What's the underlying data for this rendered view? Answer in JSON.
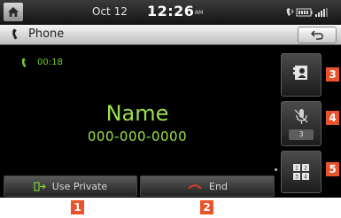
{
  "status_bar": {
    "date": "Oct 12",
    "time": "12:26",
    "ampm": "AM",
    "icons": [
      "home-icon",
      "bluetooth-phone-icon",
      "battery-icon",
      "signal-icon"
    ]
  },
  "title_bar": {
    "title": "Phone",
    "icon": "phone-icon",
    "back_icon": "back-arrow-icon"
  },
  "call": {
    "timer": "00:18",
    "name": "Name",
    "number": "000-000-0000"
  },
  "side_buttons": {
    "contacts_icon": "contacts-icon",
    "mute_icon": "mic-mute-icon",
    "mute_value": "3",
    "keypad_icon": "keypad-icon"
  },
  "bottom_buttons": {
    "use_private": "Use Private",
    "end": "End"
  },
  "callouts": [
    "1",
    "2",
    "3",
    "4",
    "5"
  ],
  "colors": {
    "accent_green": "#9be04a",
    "callout_orange": "#e8532b",
    "end_red": "#d23a2a"
  }
}
